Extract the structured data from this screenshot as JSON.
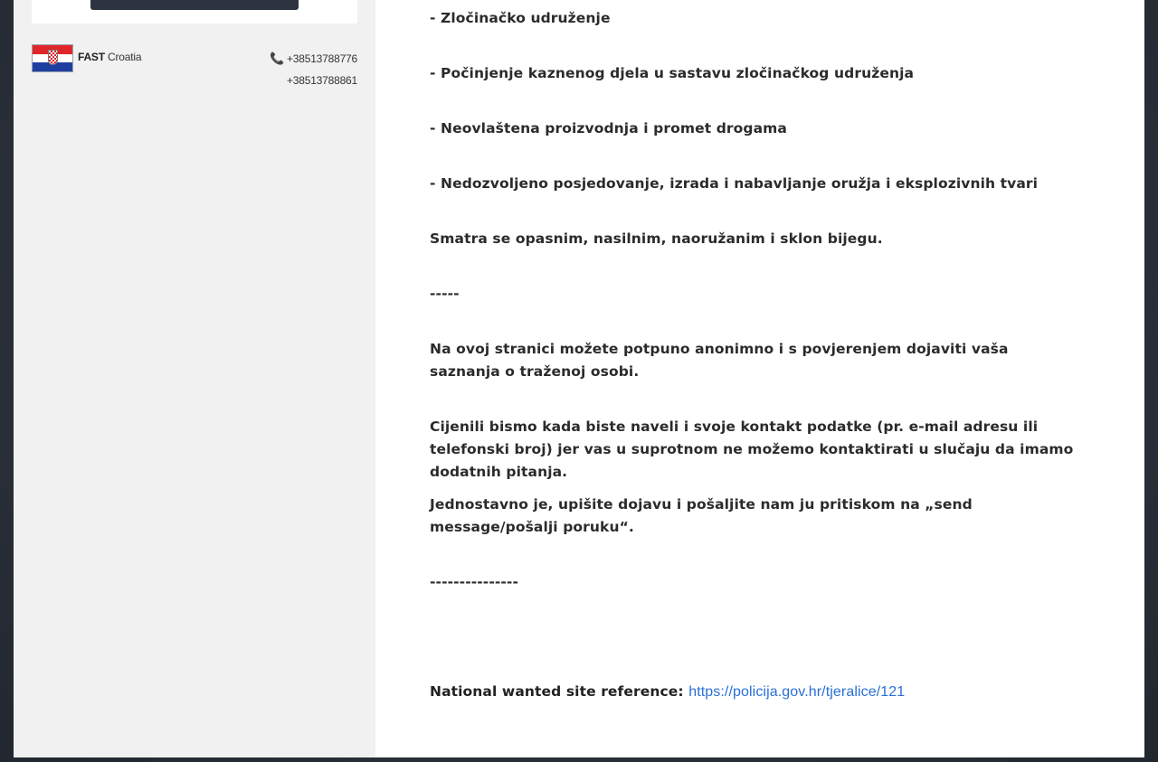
{
  "sidebar": {
    "country_brand": "FAST",
    "country_name": "Croatia",
    "phones": [
      "+38513788776",
      "+38513788861"
    ]
  },
  "content": {
    "lines": [
      "- Zločinačko udruženje",
      "- Počinjenje kaznenog djela u sastavu zločinačkog udruženja",
      "- Neovlaštena proizvodnja i promet drogama",
      "- Nedozvoljeno posjedovanje, izrada i nabavljanje oružja i eksplozivnih tvari",
      "Smatra se  opasnim, nasilnim, naoružanim i sklon bijegu.",
      "-----",
      "Na ovoj stranici možete potpuno anonimno i s povjerenjem dojaviti vaša saznanja o traženoj osobi.",
      "Cijenili bismo kada biste naveli i svoje kontakt podatke (pr. e-mail adresu ili telefonski broj) jer vas u suprotnom ne možemo kontaktirati u slučaju da imamo dodatnih pitanja.",
      "Jednostavno je, upišite dojavu i pošaljite nam ju pritiskom na „send message/pošalji poruku“.",
      "---------------"
    ],
    "reference_label": "National wanted site reference:",
    "reference_url": "https://policija.gov.hr/tjeralice/121"
  }
}
